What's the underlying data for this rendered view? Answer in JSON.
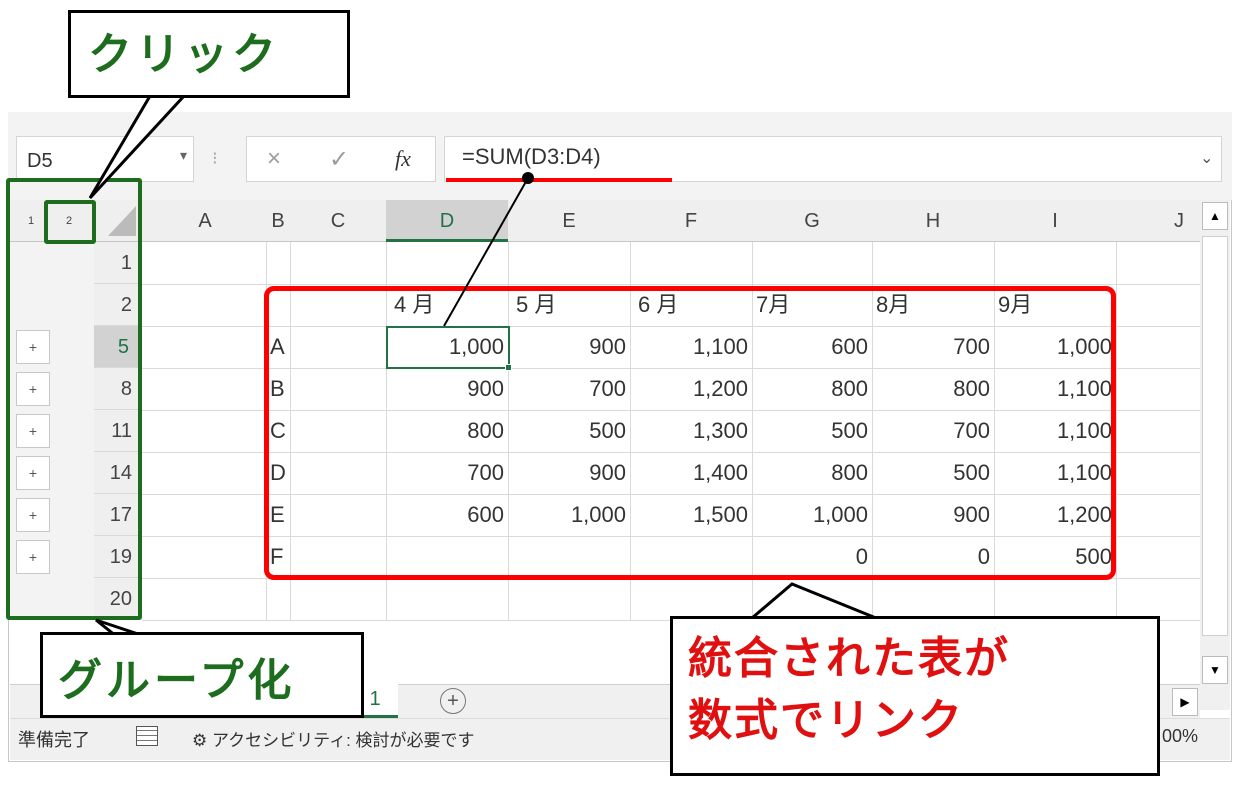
{
  "formula_bar": {
    "name_box": "D5",
    "cancel_icon": "×",
    "enter_icon": "✓",
    "fx_label": "fx",
    "formula": "=SUM(D3:D4)"
  },
  "outline_levels": [
    "1",
    "2"
  ],
  "columns": [
    "A",
    "B",
    "C",
    "D",
    "E",
    "F",
    "G",
    "H",
    "I",
    "J"
  ],
  "selected_column": "D",
  "rows": [
    {
      "num": "1",
      "expand": false,
      "b": "",
      "cells": [
        "",
        "",
        "",
        "",
        "",
        ""
      ]
    },
    {
      "num": "2",
      "expand": false,
      "b": "",
      "cells": [
        "4 月",
        "5 月",
        "6 月",
        "7月",
        "8月",
        "9月"
      ]
    },
    {
      "num": "5",
      "expand": true,
      "b": "A",
      "cells": [
        "1,000",
        "900",
        "1,100",
        "600",
        "700",
        "1,000"
      ]
    },
    {
      "num": "8",
      "expand": true,
      "b": "B",
      "cells": [
        "900",
        "700",
        "1,200",
        "800",
        "800",
        "1,100"
      ]
    },
    {
      "num": "11",
      "expand": true,
      "b": "C",
      "cells": [
        "800",
        "500",
        "1,300",
        "500",
        "700",
        "1,100"
      ]
    },
    {
      "num": "14",
      "expand": true,
      "b": "D",
      "cells": [
        "700",
        "900",
        "1,400",
        "800",
        "500",
        "1,100"
      ]
    },
    {
      "num": "17",
      "expand": true,
      "b": "E",
      "cells": [
        "600",
        "1,000",
        "1,500",
        "1,000",
        "900",
        "1,200"
      ]
    },
    {
      "num": "19",
      "expand": true,
      "b": "F",
      "cells": [
        "",
        "",
        "",
        "0",
        "0",
        "500"
      ]
    },
    {
      "num": "20",
      "expand": false,
      "b": "",
      "cells": [
        "",
        "",
        "",
        "",
        "",
        ""
      ]
    }
  ],
  "plus_symbol": "+",
  "sheet_tab": "1",
  "add_sheet": "+",
  "status": {
    "ready": "準備完了",
    "accessibility": "アクセシビリティ: 検討が必要です",
    "zoom": "00%"
  },
  "callouts": {
    "click": "クリック",
    "group": "グループ化",
    "linked_line1": "統合された表が",
    "linked_line2": "数式でリンク"
  },
  "colors": {
    "excel_green": "#217346",
    "callout_green": "#1e6d1e",
    "highlight_red": "#ff0000"
  }
}
